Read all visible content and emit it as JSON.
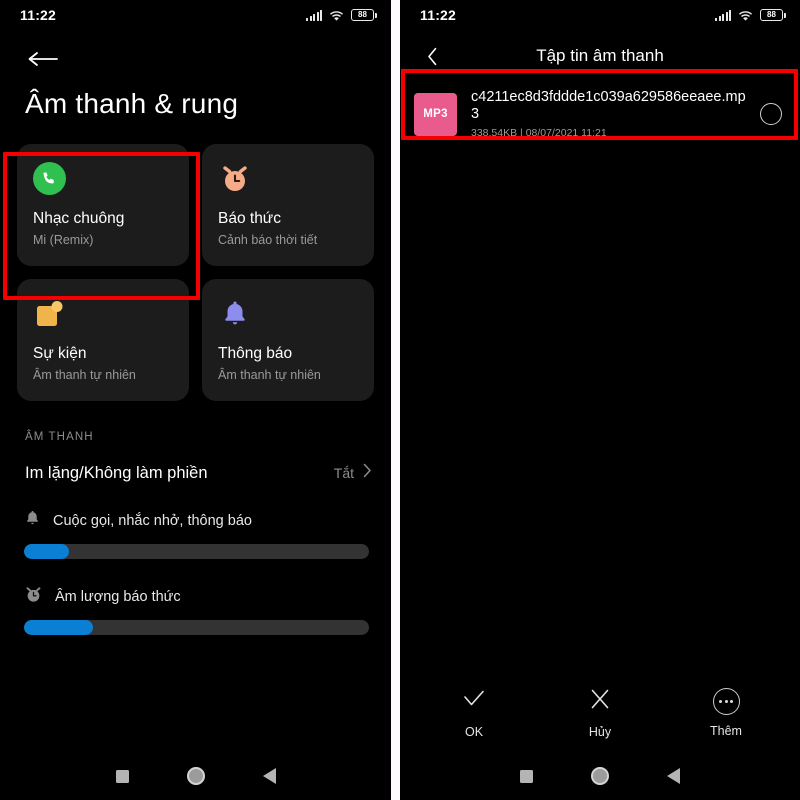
{
  "status_bar": {
    "time": "11:22",
    "battery_percent": "88",
    "signal_icon": "signal-bars-icon",
    "wifi_icon": "wifi-icon",
    "battery_icon": "battery-icon"
  },
  "left_screen": {
    "back_icon": "back-arrow-icon",
    "title": "Âm thanh & rung",
    "cards": [
      {
        "icon": "phone-icon",
        "title": "Nhạc chuông",
        "subtitle": "Mi (Remix)",
        "highlighted": true
      },
      {
        "icon": "alarm-clock-icon",
        "title": "Báo thức",
        "subtitle": "Cảnh báo thời tiết",
        "highlighted": false
      },
      {
        "icon": "calendar-event-icon",
        "title": "Sự kiện",
        "subtitle": "Âm thanh tự nhiên",
        "highlighted": false
      },
      {
        "icon": "bell-icon",
        "title": "Thông báo",
        "subtitle": "Âm thanh tự nhiên",
        "highlighted": false
      }
    ],
    "section_label": "ÂM THANH",
    "dnd_row": {
      "label": "Im lặng/Không làm phiền",
      "value": "Tắt",
      "chevron_icon": "chevron-right-icon"
    },
    "sliders": [
      {
        "icon": "bell-icon",
        "label": "Cuộc gọi, nhắc nhở, thông báo",
        "fill_percent": 13
      },
      {
        "icon": "alarm-clock-icon",
        "label": "Âm lượng báo thức",
        "fill_percent": 20
      }
    ]
  },
  "right_screen": {
    "back_icon": "chevron-left-icon",
    "title": "Tập tin âm thanh",
    "file": {
      "badge": "MP3",
      "name": "c4211ec8d3fddde1c039a629586eeaee.mp3",
      "size": "338.54KB",
      "separator": "|",
      "date": "08/07/2021 11:21",
      "radio_icon": "radio-unchecked-icon",
      "highlighted": true
    },
    "bottom_actions": [
      {
        "icon": "check-icon",
        "label": "OK"
      },
      {
        "icon": "close-icon",
        "label": "Hủy"
      },
      {
        "icon": "more-dots-icon",
        "label": "Thêm"
      }
    ]
  },
  "nav_bar": {
    "recents_icon": "square-recents-icon",
    "home_icon": "circle-home-icon",
    "back_icon": "triangle-back-icon"
  },
  "colors": {
    "highlight": "#f40000",
    "accent_slider": "#0b7fd4",
    "ringtone_green": "#2fc04f",
    "alarm_peach": "#f5ab87",
    "event_orange": "#f0b44a",
    "notification_purple": "#8d8df0",
    "mp3_pink": "#ea5b8d"
  }
}
